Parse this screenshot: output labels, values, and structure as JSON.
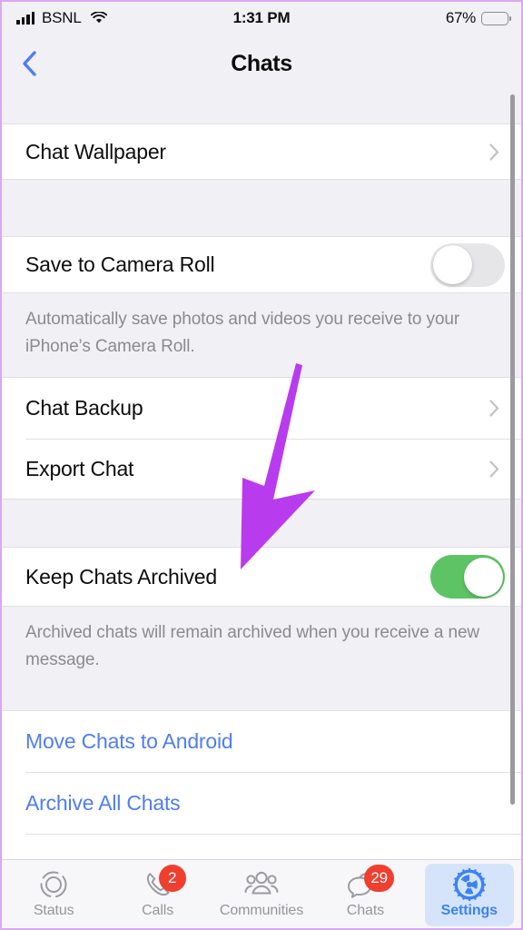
{
  "status_bar": {
    "carrier": "BSNL",
    "time": "1:31 PM",
    "battery_percent": "67%",
    "signal_icon": "signal-bars-icon",
    "wifi_icon": "wifi-icon",
    "battery_icon": "battery-icon"
  },
  "nav": {
    "title": "Chats",
    "back_icon": "chevron-left-icon"
  },
  "settings": {
    "chat_wallpaper": "Chat Wallpaper",
    "save_to_camera_roll": "Save to Camera Roll",
    "save_to_camera_roll_state": "off",
    "save_to_camera_roll_note": "Automatically save photos and videos you receive to your iPhone’s Camera Roll.",
    "chat_backup": "Chat Backup",
    "export_chat": "Export Chat",
    "keep_chats_archived": "Keep Chats Archived",
    "keep_chats_archived_state": "on",
    "keep_chats_archived_note": "Archived chats will remain archived when you receive a new message.",
    "move_chats_to_android": "Move Chats to Android",
    "archive_all_chats": "Archive All Chats"
  },
  "tab_bar": {
    "tabs": [
      {
        "label": "Status",
        "icon": "status-rings-icon",
        "badge": "",
        "active": false
      },
      {
        "label": "Calls",
        "icon": "phone-handset-icon",
        "badge": "2",
        "active": false
      },
      {
        "label": "Communities",
        "icon": "people-group-icon",
        "badge": "",
        "active": false
      },
      {
        "label": "Chats",
        "icon": "speech-bubbles-icon",
        "badge": "29",
        "active": false
      },
      {
        "label": "Settings",
        "icon": "gear-icon",
        "badge": "",
        "active": true
      }
    ]
  },
  "annotation": {
    "type": "arrow",
    "color": "#b93bee",
    "points_to": "Keep Chats Archived"
  },
  "colors": {
    "accent_blue": "#4f7df3",
    "toggle_on_green": "#5dc466",
    "badge_red": "#f03e2f",
    "group_background": "#f1f0f5",
    "cell_background": "#ffffff",
    "annotation_purple": "#b93bee",
    "tab_active_highlight": "#d5e4fb"
  }
}
